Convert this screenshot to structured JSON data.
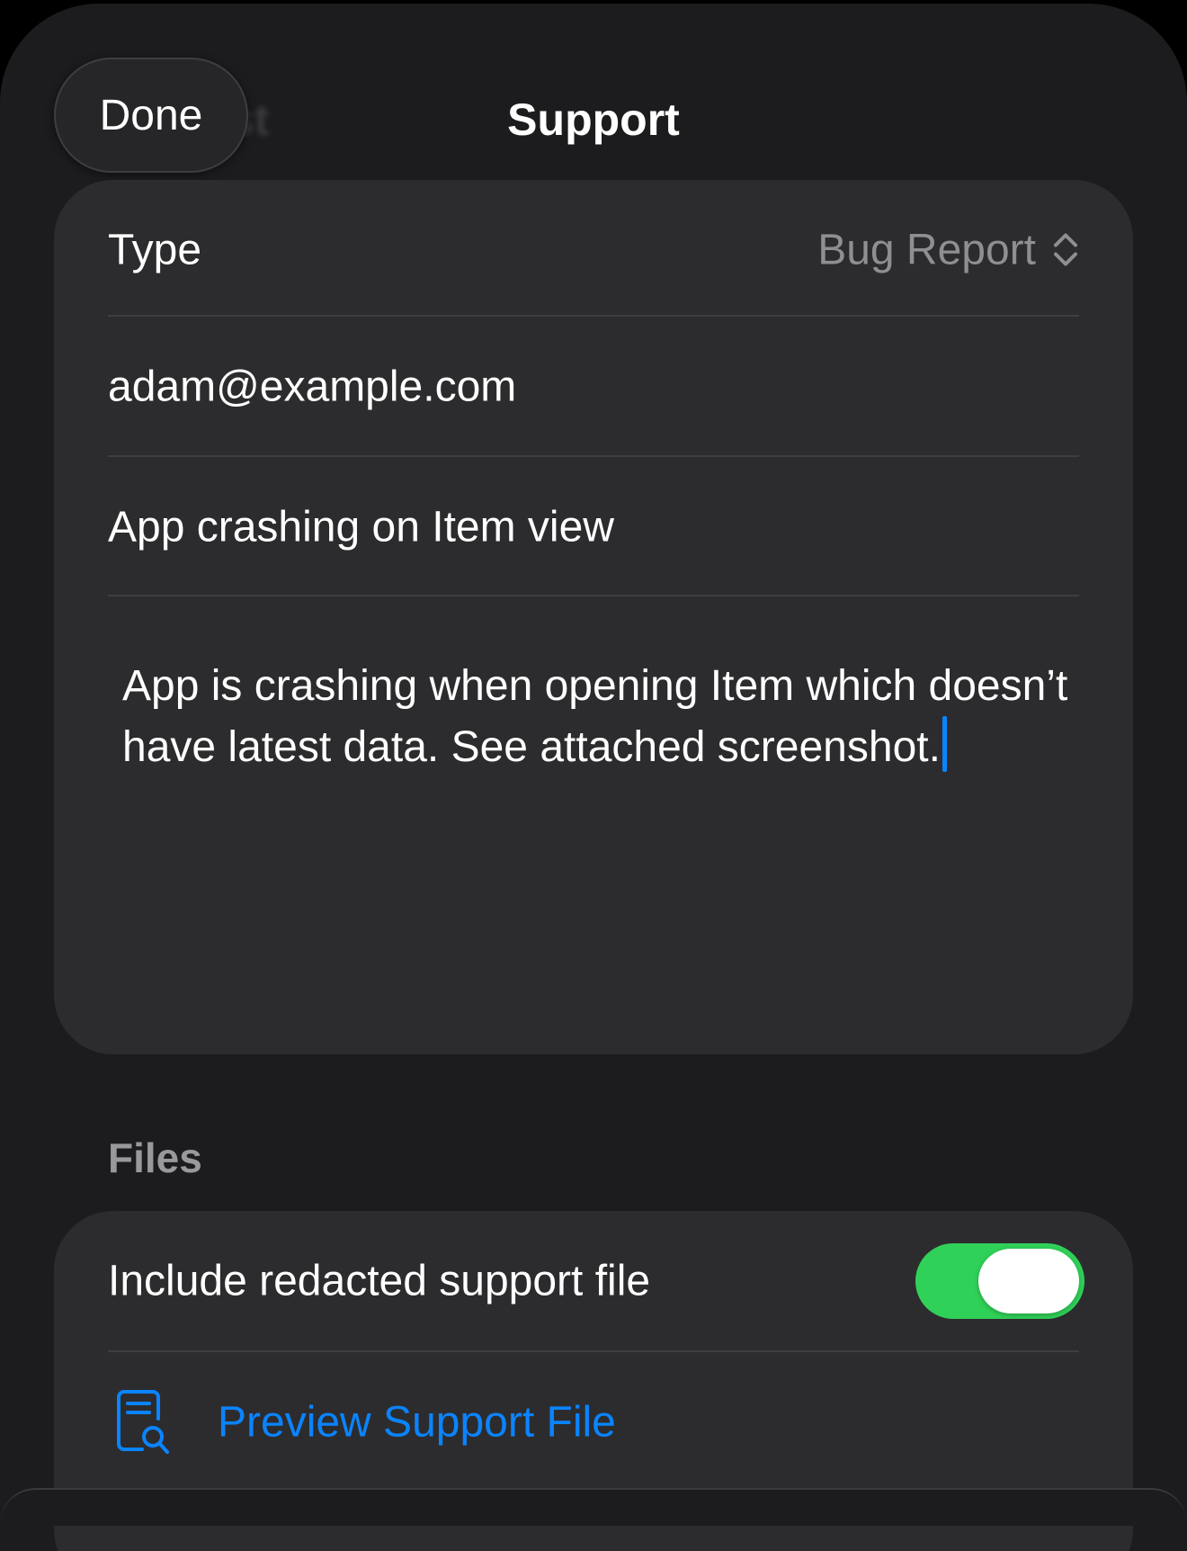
{
  "header": {
    "done_label": "Done",
    "title": "Support"
  },
  "form": {
    "type_label": "Type",
    "type_value": "Bug Report",
    "email_value": "adam@example.com",
    "subject_value": "App crashing on Item view",
    "description_value": "App is crashing when opening Item which doesn’t have latest data. See attached screenshot."
  },
  "files": {
    "section_title": "Files",
    "include_label": "Include redacted support file",
    "include_on": true,
    "preview_label": "Preview Support File"
  },
  "colors": {
    "accent": "#0a84ff",
    "toggle_on": "#30d158",
    "background": "#1c1c1e",
    "card": "#2c2c2e"
  },
  "icons": {
    "type_picker": "chevron-up-down-icon",
    "preview": "doc-magnifyingglass-icon"
  }
}
